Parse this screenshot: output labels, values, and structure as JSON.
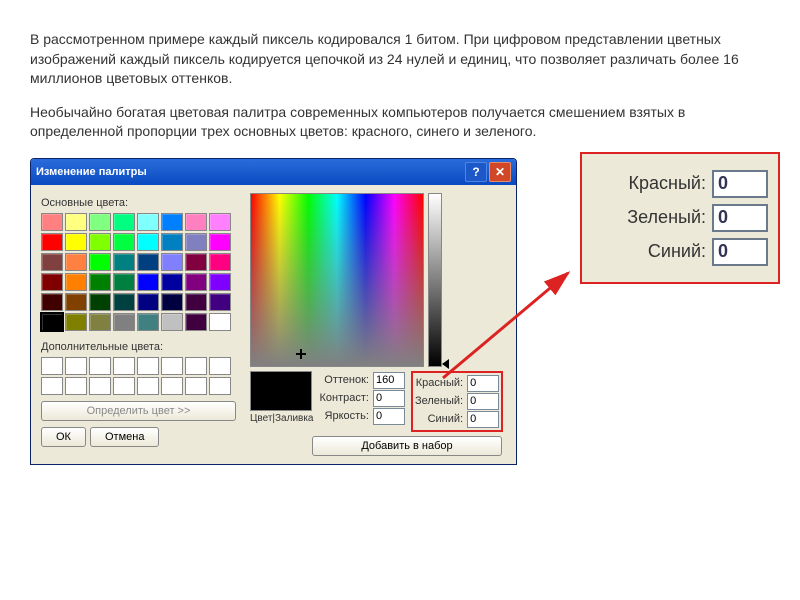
{
  "text": {
    "p1": "В рассмотренном примере каждый пиксель кодировался 1 битом. При цифровом представлении цветных изображений каждый пиксель кодируется цепочкой из 24 нулей и единиц, что позволяет различать более 16 миллионов цветовых оттенков.",
    "p2": "Необычайно богатая цветовая палитра современных компьютеров получается смешением взятых в определенной пропорции трех основных цветов: красного, синего и зеленого."
  },
  "dialog": {
    "title": "Изменение палитры",
    "help": "?",
    "close": "✕",
    "basicLabel": "Основные цвета:",
    "extraLabel": "Дополнительные цвета:",
    "defineBtn": "Определить цвет >>",
    "okBtn": "ОК",
    "cancelBtn": "Отмена",
    "addBtn": "Добавить в набор",
    "solidLabel": "Цвет|Заливка",
    "fields": {
      "hueLabel": "Оттенок:",
      "hue": "160",
      "satLabel": "Контраст:",
      "sat": "0",
      "lumLabel": "Яркость:",
      "lum": "0",
      "redLabel": "Красный:",
      "red": "0",
      "greenLabel": "Зеленый:",
      "green": "0",
      "blueLabel": "Синий:",
      "blue": "0"
    },
    "basicColors": [
      "#ff8080",
      "#ffff80",
      "#80ff80",
      "#00ff80",
      "#80ffff",
      "#0080ff",
      "#ff80c0",
      "#ff80ff",
      "#ff0000",
      "#ffff00",
      "#80ff00",
      "#00ff40",
      "#00ffff",
      "#0080c0",
      "#8080c0",
      "#ff00ff",
      "#804040",
      "#ff8040",
      "#00ff00",
      "#008080",
      "#004080",
      "#8080ff",
      "#800040",
      "#ff0080",
      "#800000",
      "#ff8000",
      "#008000",
      "#008040",
      "#0000ff",
      "#0000a0",
      "#800080",
      "#8000ff",
      "#400000",
      "#804000",
      "#004000",
      "#004040",
      "#000080",
      "#000040",
      "#400040",
      "#400080",
      "#000000",
      "#808000",
      "#808040",
      "#808080",
      "#408080",
      "#c0c0c0",
      "#400040",
      "#ffffff"
    ]
  },
  "zoom": {
    "redLabel": "Красный:",
    "greenLabel": "Зеленый:",
    "blueLabel": "Синий:",
    "value": "0"
  }
}
